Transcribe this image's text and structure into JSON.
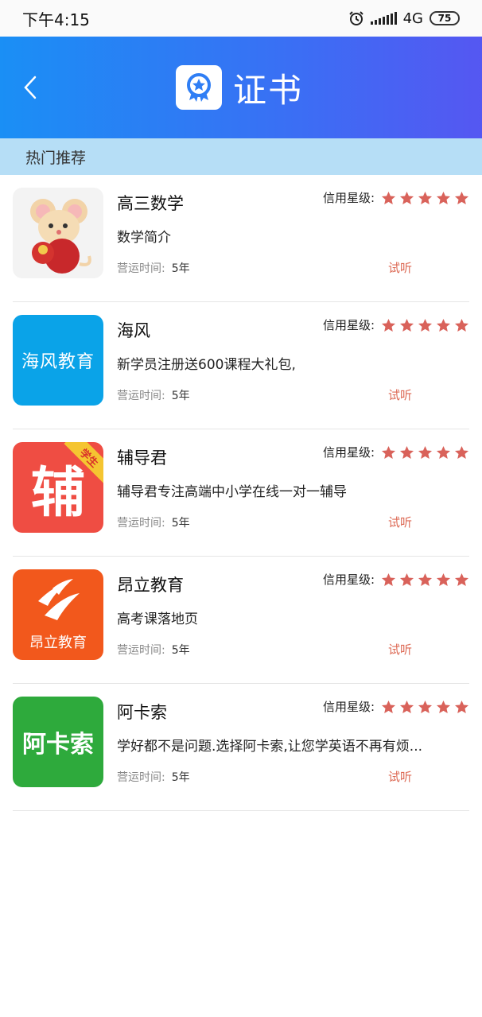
{
  "status": {
    "time": "下午4:15",
    "network": "4G",
    "battery": "75"
  },
  "header": {
    "title": "证书"
  },
  "section": {
    "title": "热门推荐"
  },
  "labels": {
    "rating": "信用星级:",
    "op_time": "营运时间:",
    "trial": "试听"
  },
  "colors": {
    "header_start": "#1a8ff5",
    "header_end": "#5557f2",
    "star": "#d9625a",
    "trial": "#dd6a55",
    "section_bg": "#b6def6"
  },
  "items": [
    {
      "name": "高三数学",
      "desc": "数学简介",
      "stars": 5,
      "years": "5年",
      "logo": {
        "icon": "mouse-mascot-icon",
        "text": ""
      }
    },
    {
      "name": "海风",
      "desc": "新学员注册送600课程大礼包,",
      "stars": 5,
      "years": "5年",
      "logo": {
        "icon": "haifeng-logo-icon",
        "text": "海风教育"
      }
    },
    {
      "name": "辅导君",
      "desc": "辅导君专注高端中小学在线一对一辅导",
      "stars": 5,
      "years": "5年",
      "logo": {
        "icon": "fudaojun-logo-icon",
        "text": "辅",
        "tag": "学生"
      }
    },
    {
      "name": "昂立教育",
      "desc": "高考课落地页",
      "stars": 5,
      "years": "5年",
      "logo": {
        "icon": "angli-logo-icon",
        "text": "昂立教育"
      }
    },
    {
      "name": "阿卡索",
      "desc": "学好都不是问题.选择阿卡索,让您学英语不再有烦...",
      "stars": 5,
      "years": "5年",
      "logo": {
        "icon": "acadsoc-logo-icon",
        "text": "阿卡索"
      }
    }
  ]
}
